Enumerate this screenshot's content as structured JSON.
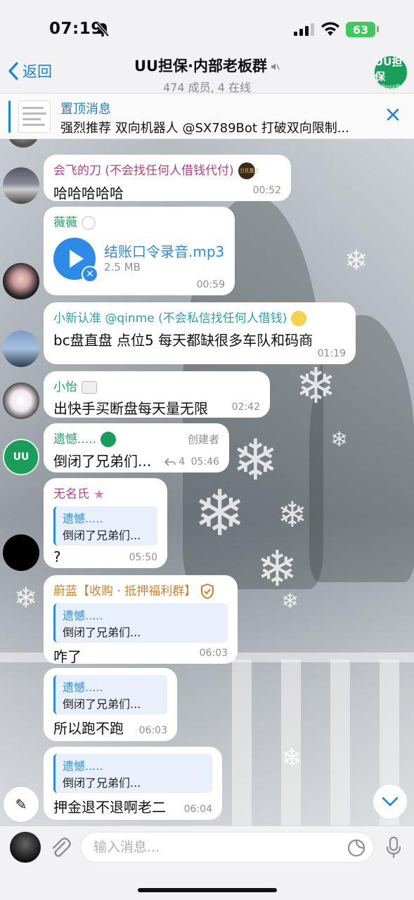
{
  "status": {
    "time": "07:19",
    "battery": "63"
  },
  "header": {
    "back_label": "返回",
    "title": "UU担保·内部老板群",
    "subtitle": "474 成员, 4 在线",
    "avatar_top": "UU担保",
    "avatar_bottom": "@uudb"
  },
  "pinned": {
    "title": "置顶消息",
    "text": "强烈推荐 双向机器人 @SX789Bot 打破双向限制..."
  },
  "messages": [
    {
      "sender": "会飞的刀 (不会找任何人借钱代付)",
      "sender_color": "#c43b7a",
      "badge": "刀氏集团",
      "text": "哈哈哈哈哈",
      "time": "00:52"
    },
    {
      "sender": "薇薇",
      "sender_color": "#2f9a6a",
      "file_name": "结账口令录音.mp3",
      "file_size": "2.5 MB",
      "time": "00:59"
    },
    {
      "sender": "小新认准 @qinme (不会私信找任何人借钱)",
      "sender_color": "#2a9fb5",
      "text": "bc盘直盘 点位5 每天都缺很多车队和码商",
      "time": "01:19"
    },
    {
      "sender": "小怡",
      "sender_color": "#2f9a6a",
      "text": "出快手买断盘每天量无限",
      "time": "02:42"
    },
    {
      "sender": "遗憾.....",
      "sender_color": "#2f9a6a",
      "role": "创建者",
      "text": "倒闭了兄弟们...",
      "replies": "4",
      "time": "05:46"
    },
    {
      "sender": "无名氏",
      "sender_color": "#c43b7a",
      "quote_name": "遗憾.....",
      "quote_text": "倒闭了兄弟们...",
      "text": "?",
      "time": "05:50"
    },
    {
      "sender": "蔚蓝【收购 · 抵押福利群】",
      "sender_color": "#d4802a",
      "quote_name": "遗憾.....",
      "quote_text": "倒闭了兄弟们...",
      "text": "咋了",
      "time": "06:03"
    },
    {
      "quote_name": "遗憾.....",
      "quote_text": "倒闭了兄弟们...",
      "text": "所以跑不跑",
      "time": "06:03"
    },
    {
      "quote_name": "遗憾.....",
      "quote_text": "倒闭了兄弟们...",
      "text": "押金退不退啊老二",
      "time": "06:04"
    }
  ],
  "input": {
    "placeholder": "输入消息..."
  },
  "colors": {
    "accent": "#1a82e2",
    "bubble": "#ffffff",
    "brand_green": "#1a9c5a"
  }
}
